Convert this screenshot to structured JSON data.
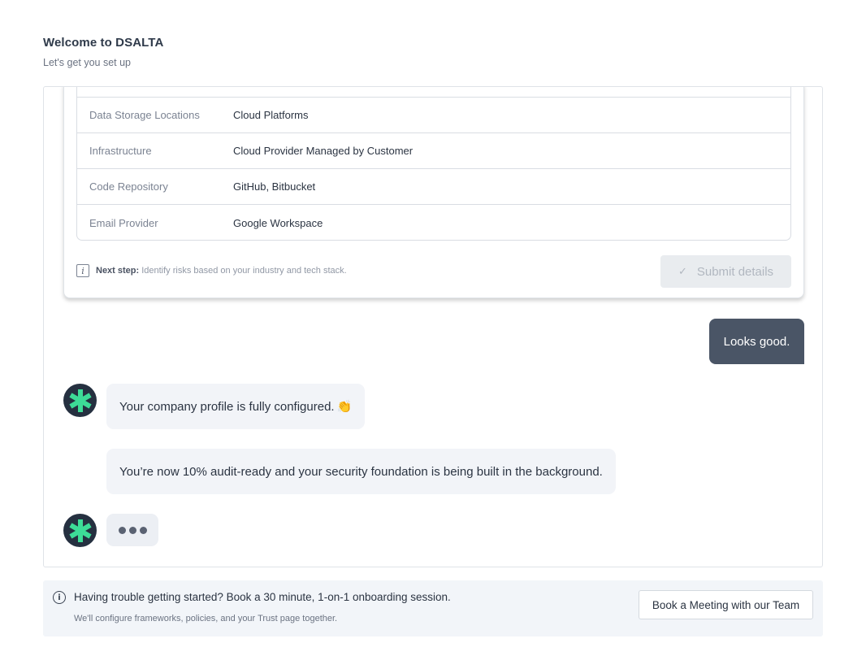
{
  "header": {
    "title": "Welcome to DSALTA",
    "subtitle": "Let's get you set up"
  },
  "profile_card": {
    "rows": [
      {
        "key": "Data Storage Locations",
        "value": "Cloud Platforms"
      },
      {
        "key": "Infrastructure",
        "value": "Cloud Provider Managed by Customer"
      },
      {
        "key": "Code Repository",
        "value": "GitHub, Bitbucket"
      },
      {
        "key": "Email Provider",
        "value": "Google Workspace"
      }
    ],
    "next_step_label": "Next step:",
    "next_step_text": "Identify risks based on your industry and tech stack.",
    "submit_label": "Submit details",
    "submit_icon": "check-icon"
  },
  "messages": {
    "user_reply": "Looks good.",
    "bot_message_1": "Your company profile is fully configured.",
    "bot_message_1_emoji": "👏",
    "bot_message_2": "You’re now 10% audit-ready and your security foundation is being built in the background."
  },
  "help_banner": {
    "icon": "info-icon",
    "title": "Having trouble getting started? Book a 30 minute, 1-on-1 onboarding session.",
    "subtitle": "We'll configure frameworks, policies, and your Trust page together.",
    "button_label": "Book a Meeting with our Team"
  },
  "colors": {
    "brand_accent": "#3ddc97",
    "avatar_bg": "#253040",
    "user_bubble": "#4a5566",
    "bot_bubble": "#f2f4f8"
  }
}
